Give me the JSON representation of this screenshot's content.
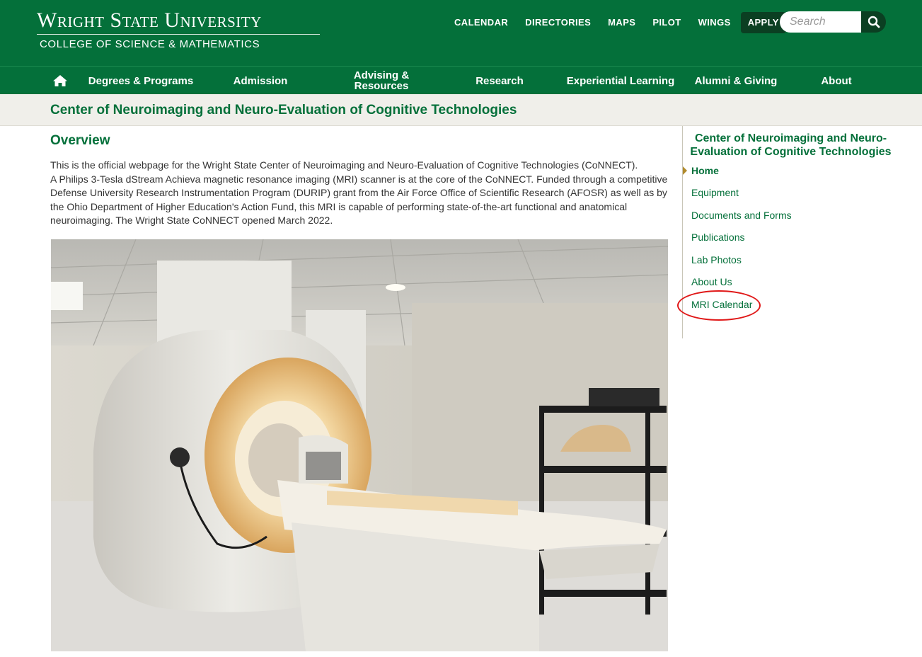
{
  "header": {
    "university": "Wright State University",
    "college": "College of Science & Mathematics",
    "utility_links": [
      "CALENDAR",
      "DIRECTORIES",
      "MAPS",
      "PILOT",
      "WINGS"
    ],
    "apply_label": "APPLY",
    "search_placeholder": "Search"
  },
  "nav": {
    "degrees": "Degrees & Programs",
    "admission": "Admission",
    "advising_line1": "Advising &",
    "advising_line2": "Resources",
    "research": "Research",
    "experiential": "Experiential Learning",
    "alumni": "Alumni & Giving",
    "about": "About"
  },
  "page_title": "Center of Neuroimaging and Neuro-Evaluation of Cognitive Technologies",
  "main": {
    "heading": "Overview",
    "intro": "This is the official webpage for the Wright State Center of Neuroimaging and Neuro-Evaluation of Cognitive Technologies (CoNNECT).",
    "body": "A Philips 3-Tesla dStream Achieva magnetic resonance imaging (MRI) scanner is at the core of the CoNNECT. Funded through a competitive Defense University Research Instrumentation Program (DURIP) grant from the Air Force Office of Scientific Research (AFOSR) as well as by the Ohio Department of Higher Education's Action Fund, this MRI is capable of performing state-of-the-art functional and anatomical neuroimaging. The Wright State CoNNECT opened March 2022."
  },
  "sidebar": {
    "title": "Center of Neuroimaging and Neuro-Evaluation of Cognitive Technologies",
    "links": [
      "Home",
      "Equipment",
      "Documents and Forms",
      "Publications",
      "Lab Photos",
      "About Us",
      "MRI Calendar"
    ]
  },
  "colors": {
    "brand_green": "#04703a",
    "dark_green": "#0b3f22",
    "gold_accent": "#b08a2c",
    "highlight_red": "#e01818"
  }
}
